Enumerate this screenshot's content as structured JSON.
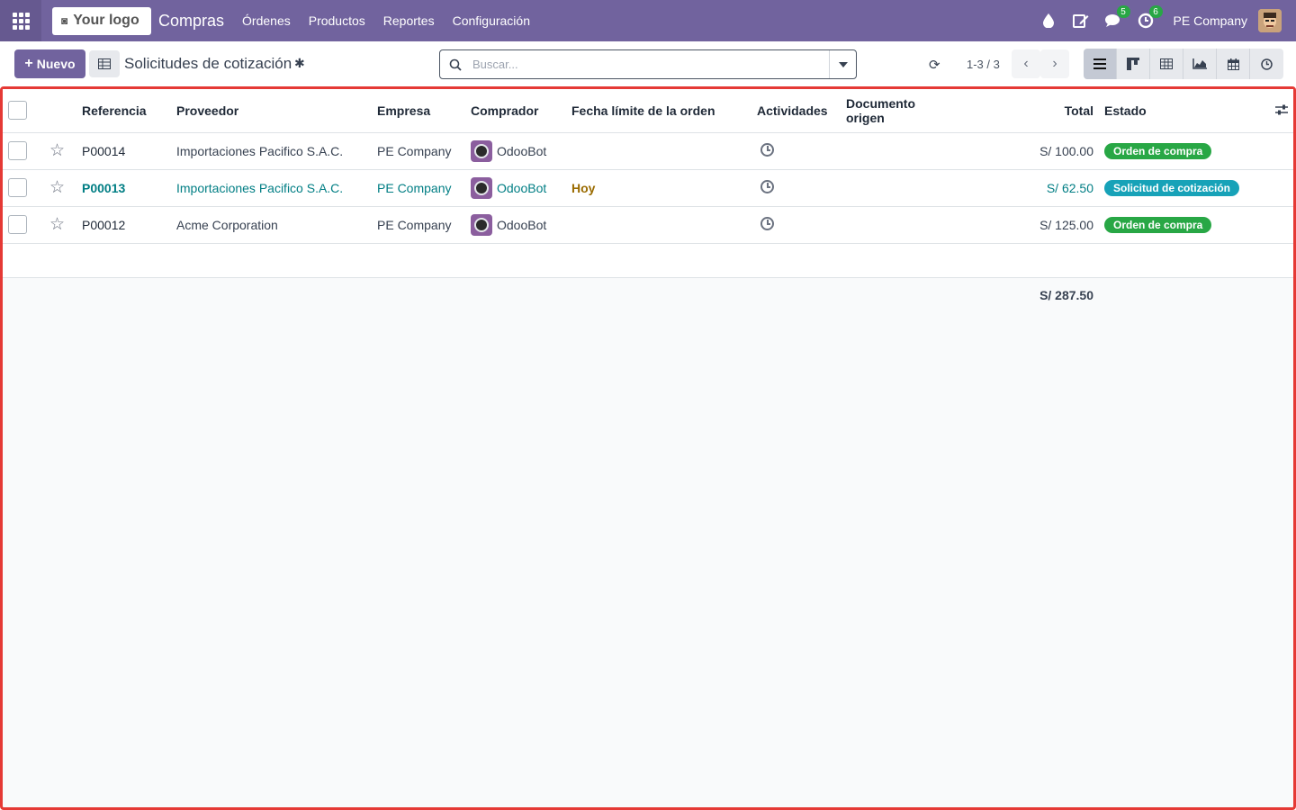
{
  "navbar": {
    "logo_text": "Your logo",
    "app_name": "Compras",
    "menu": [
      "Órdenes",
      "Productos",
      "Reportes",
      "Configuración"
    ],
    "messages_count": "5",
    "activities_count": "6",
    "company": "PE Company"
  },
  "control": {
    "new_label": "Nuevo",
    "title": "Solicitudes de cotización",
    "search_placeholder": "Buscar...",
    "pager": "1-3 / 3"
  },
  "table": {
    "columns": [
      "Referencia",
      "Proveedor",
      "Empresa",
      "Comprador",
      "Fecha límite de la orden",
      "Actividades",
      "Documento origen",
      "Total",
      "Estado"
    ],
    "rows": [
      {
        "ref": "P00014",
        "vendor": "Importaciones Pacifico S.A.C.",
        "company": "PE Company",
        "buyer": "OdooBot",
        "deadline": "",
        "origin": "",
        "total": "S/ 100.00",
        "state": "Orden de compra"
      },
      {
        "ref": "P00013",
        "vendor": "Importaciones Pacifico S.A.C.",
        "company": "PE Company",
        "buyer": "OdooBot",
        "deadline": "Hoy",
        "origin": "",
        "total": "S/ 62.50",
        "state": "Solicitud de cotización"
      },
      {
        "ref": "P00012",
        "vendor": "Acme Corporation",
        "company": "PE Company",
        "buyer": "OdooBot",
        "deadline": "",
        "origin": "",
        "total": "S/ 125.00",
        "state": "Orden de compra"
      }
    ],
    "grand_total": "S/ 287.50"
  },
  "colors": {
    "navbar": "#71639e",
    "state_po": "#28a745",
    "state_rfq": "#17a2b8",
    "link": "#017e84",
    "highlight_border": "#e53935"
  }
}
